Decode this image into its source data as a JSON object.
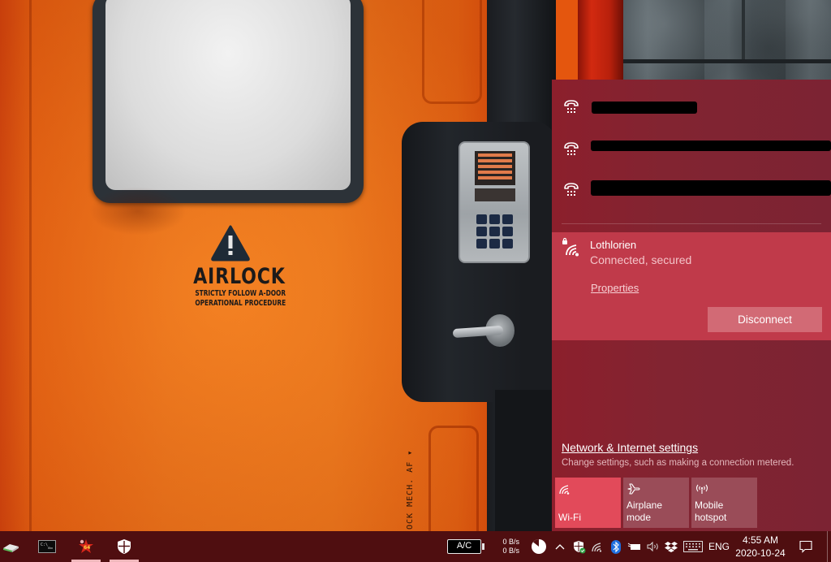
{
  "wallpaper": {
    "sign_title": "AIRLOCK",
    "sign_line1": "STRICTLY FOLLOW A-DOOR",
    "sign_line2": "OPERATIONAL PROCEDURE",
    "side_text": "OCK MECH. AF ▾"
  },
  "flyout": {
    "networks": [
      {
        "icon": "dialup-icon",
        "name": "[redacted]"
      },
      {
        "icon": "dialup-icon",
        "name": "[redacted]"
      },
      {
        "icon": "dialup-icon",
        "name": "[redacted]"
      }
    ],
    "connected": {
      "icon": "wifi-secured-icon",
      "name": "Lothlorien",
      "status": "Connected, secured",
      "properties_label": "Properties",
      "disconnect_label": "Disconnect"
    },
    "settings_link": "Network & Internet settings",
    "settings_desc": "Change settings, such as making a connection metered.",
    "quick_actions": [
      {
        "id": "wifi",
        "icon": "wifi-icon",
        "label": "Wi-Fi",
        "active": true
      },
      {
        "id": "airplane",
        "icon": "airplane-icon",
        "label": "Airplane mode",
        "active": false
      },
      {
        "id": "hotspot",
        "icon": "hotspot-icon",
        "label_line1": "Mobile",
        "label_line2": "hotspot",
        "active": false
      }
    ]
  },
  "taskbar": {
    "pinned": [
      {
        "icon": "storage-drive-icon"
      },
      {
        "icon": "terminal-icon"
      },
      {
        "icon": "app-64-icon",
        "badge": "64"
      },
      {
        "icon": "windows-security-icon"
      }
    ],
    "battery_label": "A/C",
    "net_up": "0 B/s",
    "net_down": "0 B/s",
    "tray_icons": [
      "pie-chart-icon",
      "chevron-up-icon",
      "defender-icon",
      "wifi-icon",
      "bluetooth-icon",
      "power-icon",
      "volume-icon",
      "dropbox-icon",
      "keyboard-icon"
    ],
    "language": "ENG",
    "time": "4:55 AM",
    "date": "2020-10-24",
    "notification_icon": "action-center-icon"
  },
  "colors": {
    "flyout_bg": "#822431",
    "connected_bg": "#c03a4a",
    "tile_active": "#e24a5a",
    "tile_inactive": "#9a4c58",
    "taskbar_bg": "#4f0e10"
  }
}
